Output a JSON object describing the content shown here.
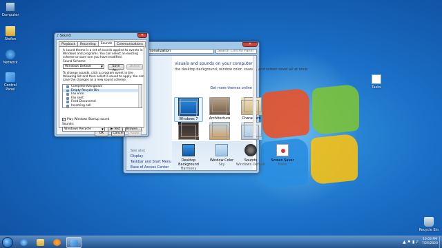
{
  "desktop": {
    "icons": [
      {
        "label": "Computer"
      },
      {
        "label": "Stefan"
      },
      {
        "label": "Network"
      },
      {
        "label": "Control Panel"
      },
      {
        "label": "Tasks"
      },
      {
        "label": "Recycle Bin"
      }
    ]
  },
  "control_panel": {
    "address": "▸ Personalization",
    "search_placeholder": "Search Control Panel",
    "heading": "visuals and sounds on your computer",
    "description": "the desktop background, window color, sounds, and screen saver all at once.",
    "get_more": "Get more themes online",
    "themes": [
      {
        "label": "Windows 7"
      },
      {
        "label": "Architecture"
      },
      {
        "label": "Characters"
      },
      {
        "label": ""
      },
      {
        "label": ""
      },
      {
        "label": ""
      }
    ],
    "see_also": "See also",
    "side_links": [
      "Display",
      "Taskbar and Start Menu",
      "Ease of Access Center"
    ],
    "bottom": [
      {
        "label": "Desktop Background",
        "sub": "Harmony"
      },
      {
        "label": "Window Color",
        "sub": "Sky"
      },
      {
        "label": "Sounds",
        "sub": "Windows Default"
      },
      {
        "label": "Screen Saver",
        "sub": "None"
      }
    ]
  },
  "sound_dialog": {
    "title": "Sound",
    "close": "✕",
    "tabs": [
      "Playback",
      "Recording",
      "Sounds",
      "Communications"
    ],
    "intro": "A sound theme is a set of sounds applied to events in Windows and programs. You can select an existing scheme or save one you have modified.",
    "scheme_label": "Sound Scheme:",
    "scheme_value": "Windows Default",
    "save_as": "Save As...",
    "delete": "Delete",
    "events_help": "To change sounds, click a program event in the following list and then select a sound to apply. You can save the changes as a new sound scheme.",
    "events_label": "Program Events:",
    "events": [
      "Complete Navigation",
      "Empty Recycle Bin",
      "Fax error",
      "Fax sent",
      "Feed Discovered",
      "Incoming call"
    ],
    "startup_label": "Play Windows Startup sound",
    "sounds_label": "Sounds:",
    "sounds_value": "Windows Recycle",
    "test": "▶ Test",
    "browse": "Browse...",
    "ok": "OK",
    "cancel": "Cancel",
    "apply": "Apply"
  },
  "taskbar": {
    "time": "10:03 PM",
    "date": "7/26/2020"
  }
}
